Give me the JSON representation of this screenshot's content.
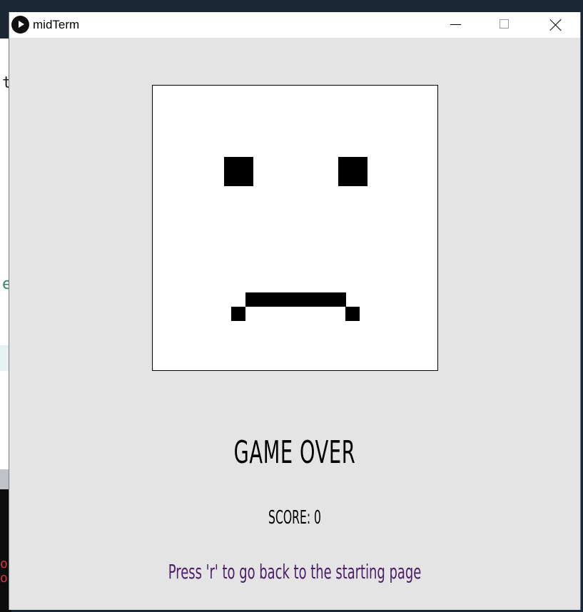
{
  "window": {
    "title": "midTerm",
    "app_icon": "play-icon",
    "controls": {
      "minimize_icon": "minimize-icon",
      "maximize_icon": "maximize-icon",
      "close_icon": "close-icon"
    }
  },
  "background_editor": {
    "visible_chars": [
      "t",
      "e",
      "ov",
      "o"
    ],
    "colors": {
      "code_text": "#222222",
      "keyword": "#2a8a6a",
      "error": "#e03040"
    }
  },
  "game": {
    "face_expression": "sad",
    "game_over_label": "GAME OVER",
    "score_label": "SCORE: 0",
    "restart_hint": "Press 'r' to go back to the starting page",
    "colors": {
      "background": "#e4e4e4",
      "panel": "#ffffff",
      "pixels": "#000000",
      "hint_text": "#4b1f66"
    }
  }
}
